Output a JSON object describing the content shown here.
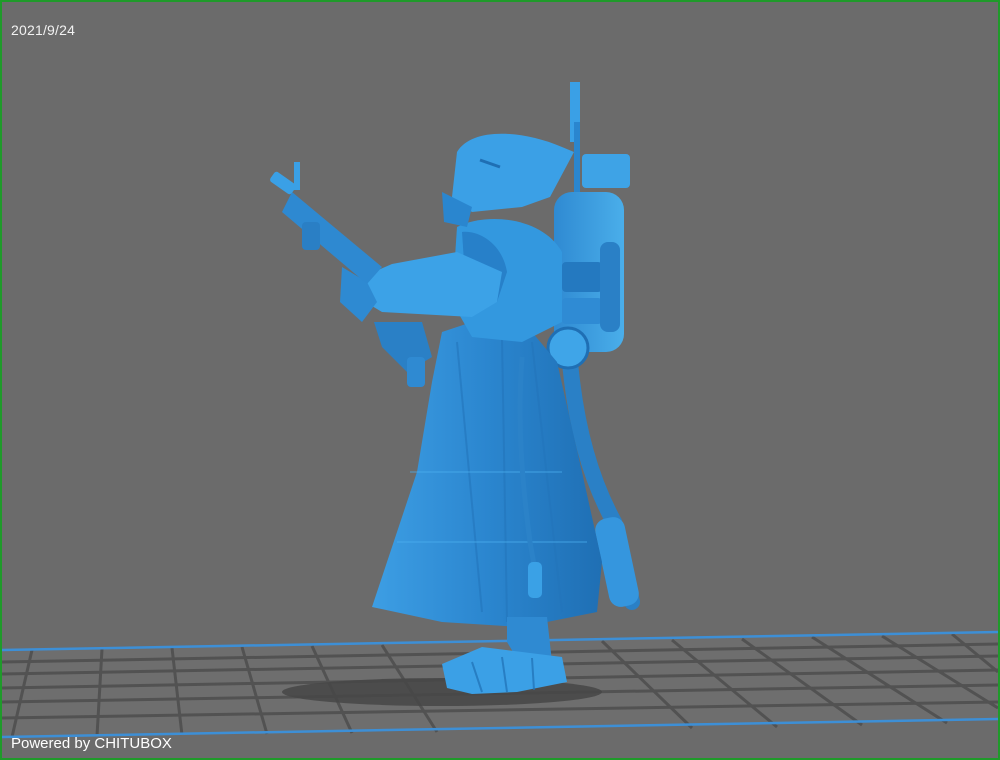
{
  "overlay": {
    "date": "2021/9/24",
    "watermark": "Powered by CHITUBOX"
  },
  "viewport": {
    "background_color": "#6b6b6b",
    "frame_color": "#1f9a2a",
    "build_plate_edge_color": "#3d8fd6",
    "model_color": "#2e8fd8"
  }
}
